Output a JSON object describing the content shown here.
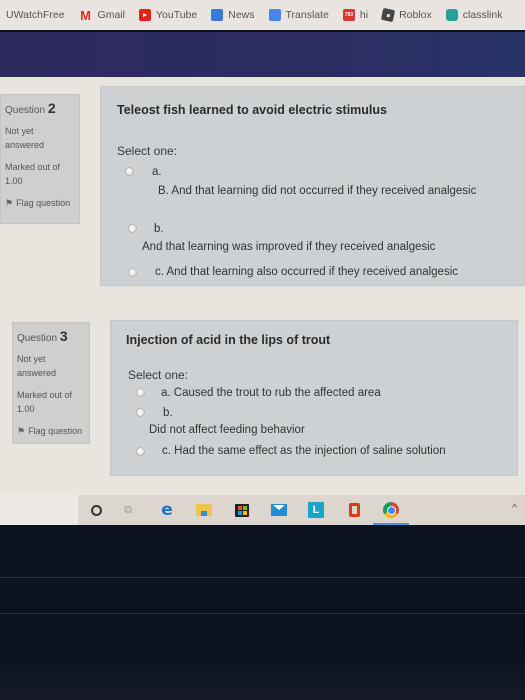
{
  "bookmarks": [
    {
      "label": "UWatchFree",
      "icon": "none"
    },
    {
      "label": "Gmail",
      "icon": "gmail-icon"
    },
    {
      "label": "YouTube",
      "icon": "youtube-icon"
    },
    {
      "label": "News",
      "icon": "news-icon"
    },
    {
      "label": "Translate",
      "icon": "translate-icon"
    },
    {
      "label": "hi",
      "icon": "hi-icon",
      "icon_text": "783"
    },
    {
      "label": "Roblox",
      "icon": "roblox-icon"
    },
    {
      "label": "classlink",
      "icon": "classlink-icon"
    }
  ],
  "gmail_glyph": "M",
  "questions": [
    {
      "number_prefix": "Question",
      "number": "2",
      "status": "Not yet answered",
      "marked": "Marked out of 1.00",
      "flag_label": "Flag question",
      "text": "Teleost fish learned to avoid electric stimulus",
      "select_one": "Select one:",
      "options": [
        {
          "letter": "a.",
          "text": "B. And that learning did not occurred if they received analgesic"
        },
        {
          "letter": "b.",
          "text": "And that learning was improved if they received analgesic"
        },
        {
          "letter": "",
          "text": "c. And that learning also occurred if they received analgesic"
        }
      ]
    },
    {
      "number_prefix": "Question",
      "number": "3",
      "status": "Not yet answered",
      "marked": "Marked out of 1.00",
      "flag_label": "Flag question",
      "text": "Injection of acid in the lips of trout",
      "select_one": "Select one:",
      "options": [
        {
          "letter": "",
          "text": "a. Caused the trout to rub the affected area"
        },
        {
          "letter": "b.",
          "text": "Did not affect feeding behavior"
        },
        {
          "letter": "",
          "text": "c. Had the same effect as the injection of saline solution"
        }
      ]
    }
  ],
  "taskbar": {
    "items": [
      "cortana",
      "task-view",
      "edge",
      "file-explorer",
      "microsoft-store",
      "mail",
      "L-app",
      "office",
      "chrome"
    ],
    "edge_glyph": "e",
    "lapp_glyph": "L",
    "taskview_glyph": "⧉",
    "chevron_glyph": "^"
  },
  "colors": {
    "header_band": "#2e2a5e",
    "info_box": "#cfcfcd",
    "content_box": "#cdd1d3",
    "page_bg": "#e8e4de"
  }
}
